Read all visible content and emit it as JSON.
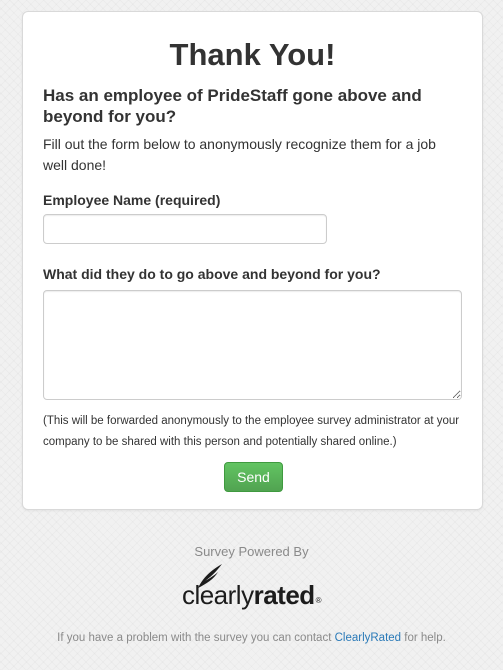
{
  "form": {
    "title": "Thank You!",
    "subtitle": "Has an employee of PrideStaff gone above and beyond for you?",
    "intro": "Fill out the form below to anonymously recognize them for a job well done!",
    "employee_name_label": "Employee Name (required)",
    "employee_name_value": "",
    "description_label": "What did they do to go above and beyond for you?",
    "description_value": "",
    "note": "(This will be forwarded anonymously to the employee survey administrator at your company to be shared with this person and potentially shared online.)",
    "send_label": "Send"
  },
  "branding": {
    "powered_by": "Survey Powered By",
    "logo_light": "clearly",
    "logo_bold": "rated",
    "logo_reg": "®",
    "logo_icon": "feather-icon"
  },
  "footer": {
    "text_before": "If you have a problem with the survey you can contact ",
    "link_label": "ClearlyRated",
    "text_after": " for help."
  },
  "colors": {
    "send_button": "#5cb85c",
    "link": "#2a7ab8",
    "muted_text": "#8a8a8a"
  }
}
